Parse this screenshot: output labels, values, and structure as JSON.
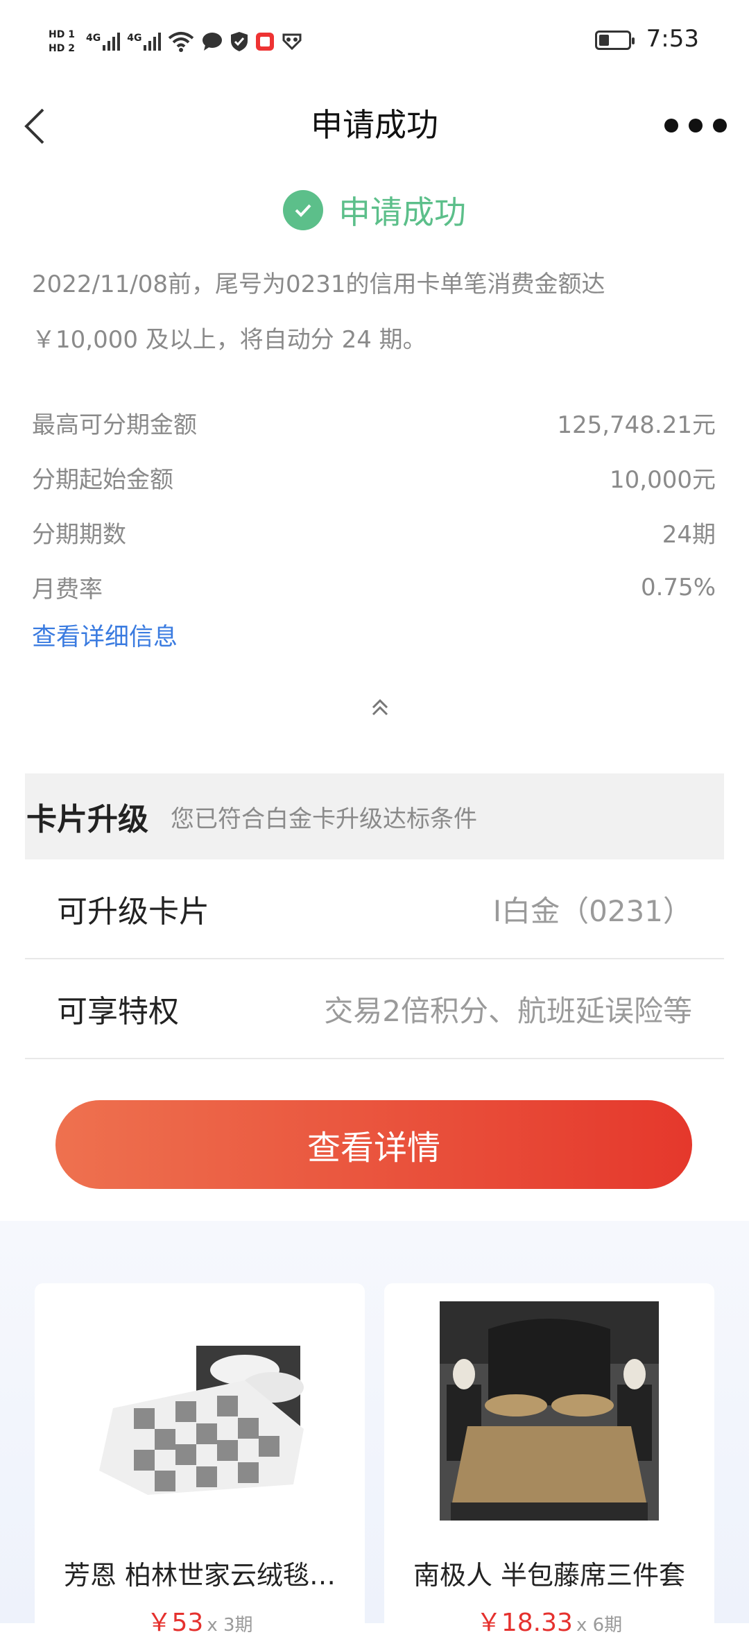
{
  "status_bar": {
    "time": "7:53",
    "hd1": "HD 1",
    "hd2": "HD 2",
    "net1": "4G",
    "net2": "4G"
  },
  "nav": {
    "title": "申请成功"
  },
  "success": {
    "text": "申请成功",
    "color": "#5cbf8a"
  },
  "description": {
    "line1": "2022/11/08前，尾号为0231的信用卡单笔消费金额达",
    "line2": "￥10,000 及以上，将自动分 24 期。"
  },
  "details": [
    {
      "label": "最高可分期金额",
      "value": "125,748.21元"
    },
    {
      "label": "分期起始金额",
      "value": "10,000元"
    },
    {
      "label": "分期期数",
      "value": "24期"
    },
    {
      "label": "月费率",
      "value": "0.75%"
    }
  ],
  "detail_link": "查看详细信息",
  "upgrade": {
    "title": "卡片升级",
    "subtitle": "您已符合白金卡升级达标条件",
    "card_label": "可升级卡片",
    "card_value": "I白金（0231）",
    "privilege_label": "可享特权",
    "privilege_value": "交易2倍积分、航班延误险等"
  },
  "cta_label": "查看详情",
  "products": [
    {
      "title": "芳恩 柏林世家云绒毯…",
      "price": "￥53",
      "installment": "x 3期"
    },
    {
      "title": "南极人 半包藤席三件套",
      "price": "￥18.33",
      "installment": "x 6期"
    }
  ]
}
